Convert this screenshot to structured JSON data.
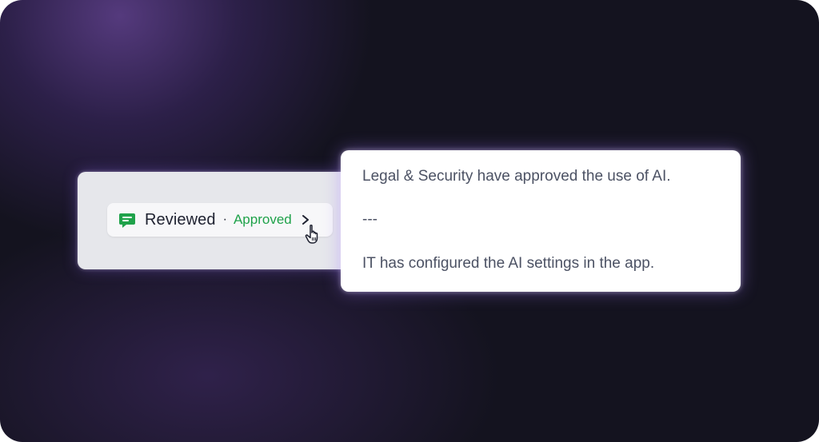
{
  "chip": {
    "icon": "chat-icon",
    "title": "Reviewed",
    "separator": "·",
    "status": "Approved",
    "chevron_icon": "chevron-right-icon",
    "cursor_icon": "hand-pointer-icon"
  },
  "popover": {
    "line1": "Legal & Security have approved the use of AI.",
    "line2": "---",
    "line3": "IT has configured the AI settings in the app."
  },
  "colors": {
    "status_green": "#1fa24a",
    "background": "#14131f",
    "glow": "#a078ff"
  }
}
